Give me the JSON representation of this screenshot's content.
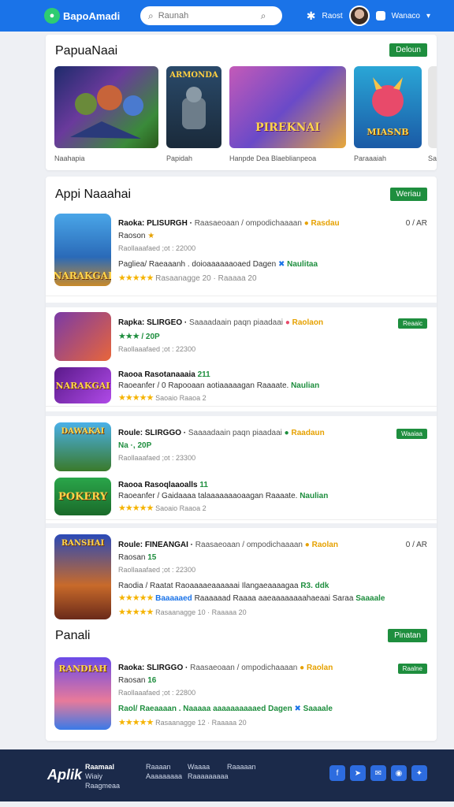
{
  "header": {
    "logo_text": "BapoAmadi",
    "search_placeholder": "Raunah",
    "link1": "Raost",
    "account_label": "Wanaco"
  },
  "featured": {
    "title": "PapuaNaai",
    "button": "Deloun",
    "tiles": [
      {
        "label": "Naahapia"
      },
      {
        "label": "Papidah",
        "art_text": "ARMONDA"
      },
      {
        "label": "Hanpde Dea Blaeblianpeoa",
        "art_text": "PIREKNAI"
      },
      {
        "label": "Paraaaiah",
        "art_text": "MIASNB"
      },
      {
        "label": "Sa"
      }
    ]
  },
  "apps": {
    "title": "Appi Naaahai",
    "button": "Weriau",
    "items": [
      {
        "art_text": "NARAKGAI",
        "name": "Raoka: PLISURGH",
        "desc": "Raasaeoaan / ompodichaaaan",
        "tag": "Rasdau",
        "sub": "Raoson",
        "size": "Raollaaafaed ;ot : 22000",
        "line": "Pagliea/ Raeaaanh . doioaaaaaaoaed Dagen",
        "tag2": "Naulitaa",
        "downloads": "Rasaanagge 20 · Raaaaa 20",
        "right": "0 / AR",
        "stars": 4
      },
      {
        "art_text": "",
        "name": "Rapka: SLIRGEO",
        "desc": "Saaaadaain paqn piaadaai",
        "tag": "Raolaon",
        "stars_text": "/ 20P",
        "size": "Raollaaafaed ;ot : 22300",
        "mini_btn": "Reaaic",
        "stars": 3
      },
      {
        "art_text": "NARAKGAI",
        "name": "Raooa Rasotanaaaia",
        "name_num": "211",
        "line": "Raoeanfer / 0 Rapooaan aotiaaaaagan Raaaate.",
        "tag2": "Naulian",
        "downloads": "Saoaio Raaoa 2",
        "stars": 4
      },
      {
        "art_text": "DAWAKAI",
        "name": "Roule: SLIRGGO",
        "desc": "Saaaadaain paqn piaadaai",
        "tag": "Raadaun",
        "stars_text": "Na ·, 20P",
        "size": "Raollaaafaed ;ot : 23300",
        "mini_btn": "Waaiaa",
        "stars": 3
      },
      {
        "art_text": "POKERY",
        "name": "Raooa Rasoqlaaoalls",
        "name_num": "11",
        "line": "Raoeanfer / Gaidaaaa talaaaaaaaoaagan Raaaate.",
        "tag2": "Naulian",
        "downloads": "Saoaio Raaoa 2",
        "stars": 4
      },
      {
        "art_text": "RANSHAI",
        "name": "Roule: FINEANGAI",
        "desc": "Raasaeoaan / ompodichaaaan",
        "tag": "Raolan",
        "sub": "Raosan",
        "sub_num": "15",
        "size": "Raollaaafaed ;ot : 22300",
        "line": "Raodia / Raatat Raoaaaaeaaaaaai Ilangaeaaaagaa",
        "tag2": "R3. ddk",
        "line2": "Baaaaaed",
        "line2b": "Raaaaaad  Raaaa aaeaaaaaaaahaeaai Saraa",
        "tag3": "Saaaale",
        "downloads": "Rasaanagge 10 · Raaaaa 20",
        "right": "0 / AR",
        "stars": 4
      }
    ]
  },
  "popular": {
    "title": "Panali",
    "button": "Pinatan",
    "item": {
      "art_text": "RANDIAH",
      "name": "Raoka: SLIRGGO",
      "desc": "Raasaeoaan / ompodichaaaan",
      "tag": "Raolan",
      "sub": "Raosan",
      "sub_num": "16",
      "size": "Raollaaafaed ;ot : 22800",
      "line": "Raol/ Raeaaaan . Naaaaa aaaaaaaaaaed Dagen",
      "tag2": "Saaaale",
      "downloads": "Rasaanagge 12 · Raaaaa 20",
      "mini_btn": "Raalne",
      "stars": 4
    }
  },
  "footer": {
    "logo": "Aplik",
    "col1": [
      "Raamaal",
      "Wiaiy",
      "Raagmeaa"
    ],
    "col2": [
      "Raaaan",
      "Aaaaaaaaa"
    ],
    "col3": [
      "Waaaa",
      "Raaaaaaaaa"
    ],
    "col4": [
      "Raaaaan"
    ]
  },
  "colors": {
    "header_bg": "#1a73e8",
    "accent_green": "#1e8e3e",
    "star": "#f5b301",
    "footer_bg": "#1b2a4a"
  }
}
